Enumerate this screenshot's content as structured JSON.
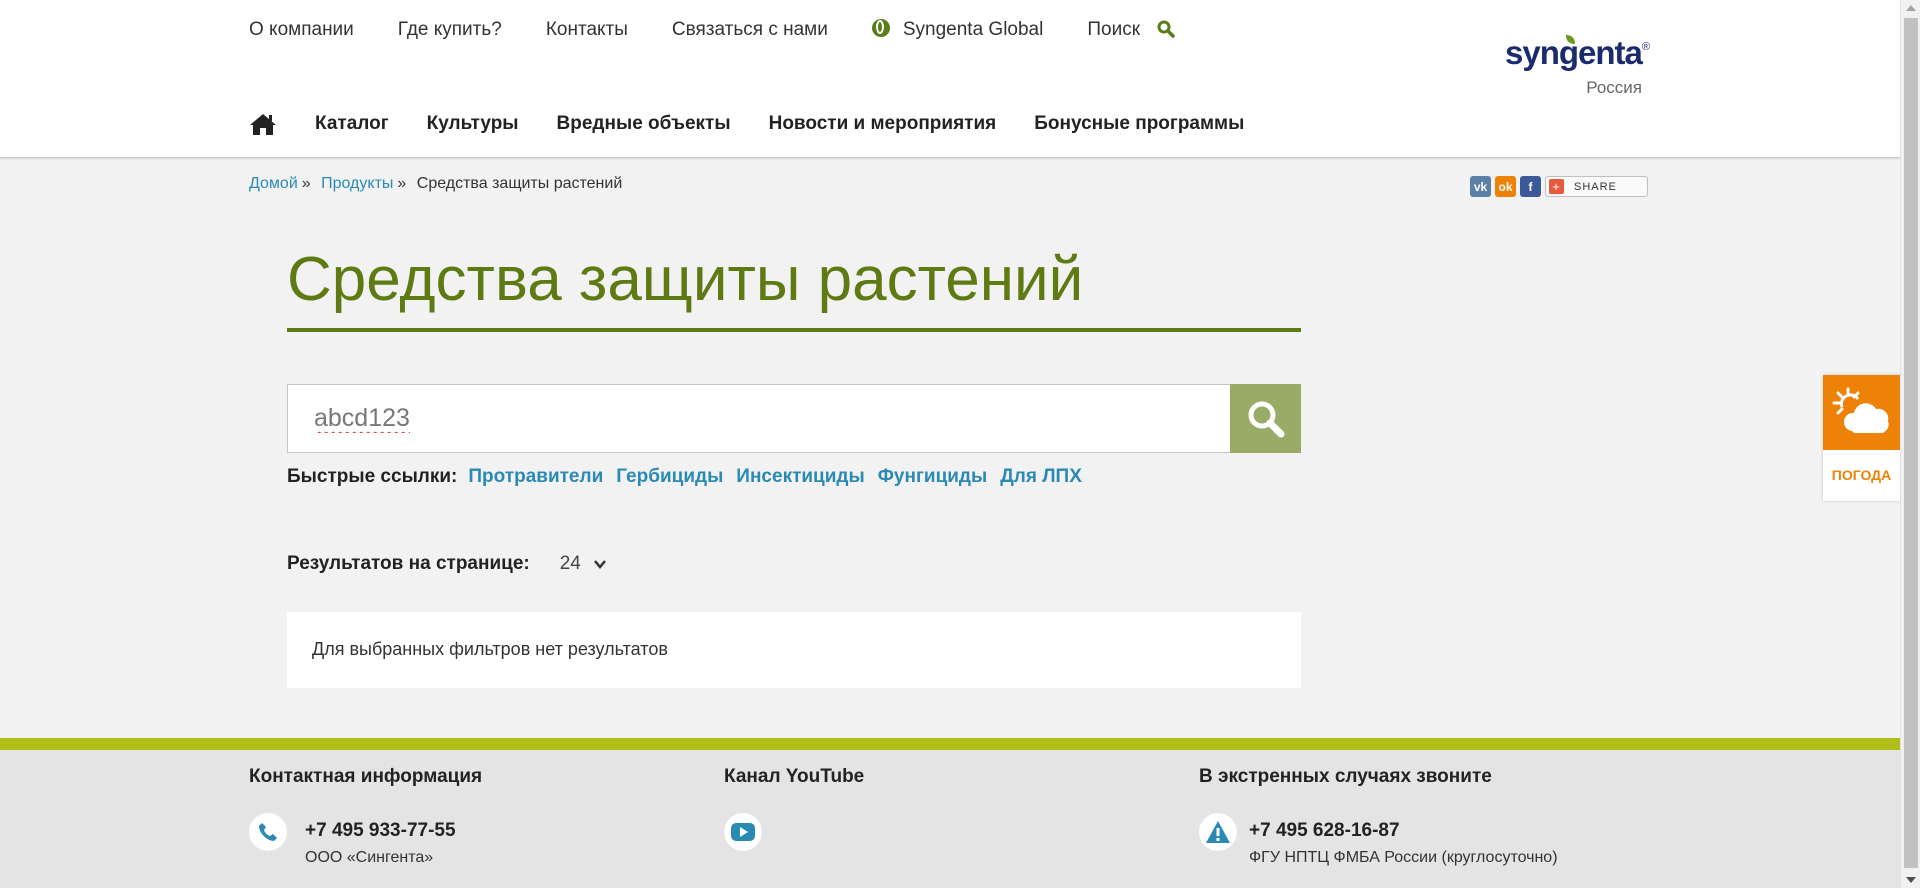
{
  "topnav": {
    "about": "О компании",
    "where_buy": "Где купить?",
    "contacts": "Контакты",
    "contact_us": "Связаться с нами",
    "global": "Syngenta Global",
    "search": "Поиск"
  },
  "logo": {
    "brand": "syngenta",
    "reg": "®",
    "country": "Россия"
  },
  "mainnav": {
    "items": [
      "Каталог",
      "Культуры",
      "Вредные объекты",
      "Новости и мероприятия",
      "Бонусные программы"
    ]
  },
  "breadcrumb": {
    "items": [
      "Домой",
      "Продукты",
      "Средства защиты растений"
    ],
    "separator": "»"
  },
  "share": {
    "vk": "vk",
    "ok": "ok",
    "fb": "f",
    "button": "SHARE"
  },
  "page_title": "Средства защиты растений",
  "search": {
    "value": "abcd123"
  },
  "quick_links": {
    "label": "Быстрые ссылки:",
    "items": [
      "Протравители",
      "Гербициды",
      "Инсектициды",
      "Фунгициды",
      "Для ЛПХ"
    ]
  },
  "per_page": {
    "label": "Результатов на странице:",
    "value": "24"
  },
  "no_results": "Для выбранных фильтров нет результатов",
  "weather": {
    "label": "ПОГОДА"
  },
  "footer": {
    "contact": {
      "heading": "Контактная информация",
      "phone": "+7 495 933-77-55",
      "company": "ООО «Сингента»"
    },
    "youtube": {
      "heading": "Канал YouTube"
    },
    "emergency": {
      "heading": "В экстренных случаях звоните",
      "phone": "+7 495 628-16-87",
      "org": "ФГУ НПТЦ ФМБА России (круглосуточно)"
    }
  },
  "colors": {
    "accent_green": "#5e7a12",
    "link_blue": "#2a8ab4",
    "search_button": "#98ac68",
    "weather_orange": "#ee8208",
    "footer_bar": "#b1be17"
  }
}
